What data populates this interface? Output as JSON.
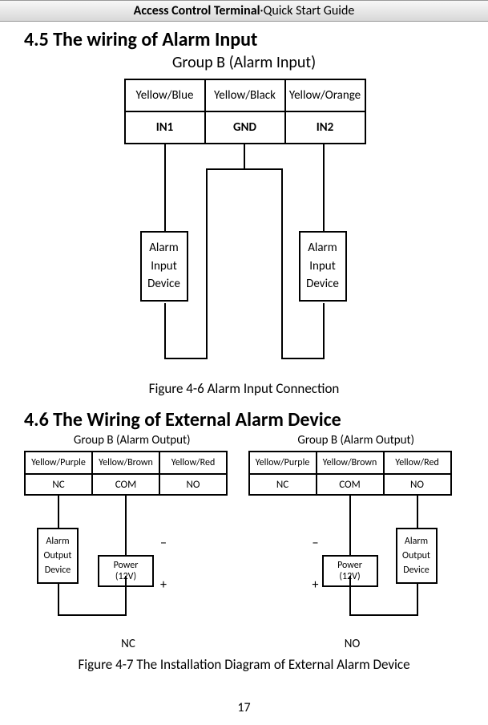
{
  "header": {
    "bold": "Access Control Terminal",
    "sep": "·",
    "rest": "Quick Start Guide"
  },
  "section1": {
    "heading": "4.5 The wiring of Alarm Input",
    "subtitle": "Group B (Alarm Input)",
    "pins": {
      "colors": [
        "Yellow/Blue",
        "Yellow/Black",
        "Yellow/Orange"
      ],
      "labels": [
        "IN1",
        "GND",
        "IN2"
      ]
    },
    "device1": "Alarm\nInput\nDevice",
    "device2": "Alarm\nInput\nDevice",
    "caption": "Figure 4-6 Alarm Input Connection"
  },
  "section2": {
    "heading": "4.6 The Wiring of External Alarm Device",
    "left": {
      "title": "Group B (Alarm Output)",
      "colors": [
        "Yellow/Purple",
        "Yellow/Brown",
        "Yellow/Red"
      ],
      "labels": [
        "NC",
        "COM",
        "NO"
      ],
      "device": "Alarm\nOutput\nDevice",
      "power": "Power (12V)",
      "minus": "−",
      "plus": "+",
      "tag": "NC"
    },
    "right": {
      "title": "Group B (Alarm Output)",
      "colors": [
        "Yellow/Purple",
        "Yellow/Brown",
        "Yellow/Red"
      ],
      "labels": [
        "NC",
        "COM",
        "NO"
      ],
      "device": "Alarm\nOutput\nDevice",
      "power": "Power (12V)",
      "minus": "−",
      "plus": "+",
      "tag": "NO"
    },
    "caption": "Figure 4-7   The Installation Diagram of External Alarm Device"
  },
  "page_number": "17"
}
